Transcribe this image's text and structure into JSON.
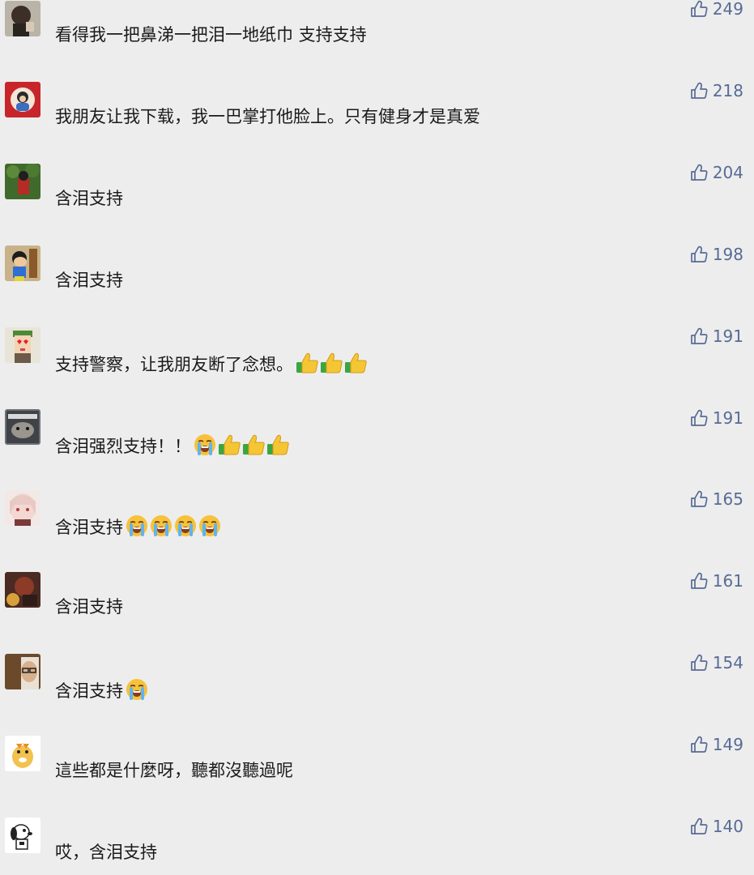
{
  "comments": [
    {
      "avatar": "avatar-dark-portrait",
      "text": "看得我一把鼻涕一把泪一地纸巾 支持支持",
      "emojis": [],
      "likes": "249"
    },
    {
      "avatar": "avatar-red-portrait",
      "text": "我朋友让我下载，我一巴掌打他脸上。只有健身才是真爱",
      "emojis": [],
      "likes": "218"
    },
    {
      "avatar": "avatar-green-outdoor",
      "text": "含泪支持",
      "emojis": [],
      "likes": "204"
    },
    {
      "avatar": "avatar-cartoon-boy",
      "text": "含泪支持",
      "emojis": [],
      "likes": "198"
    },
    {
      "avatar": "avatar-cartoon-heart-eyes",
      "text": "支持警察，让我朋友断了念想。",
      "emojis": [
        "thumbs-up-emoji",
        "thumbs-up-emoji",
        "thumbs-up-emoji"
      ],
      "likes": "191"
    },
    {
      "avatar": "avatar-cat",
      "text": "含泪强烈支持！！",
      "emojis": [
        "loudly-crying-emoji",
        "thumbs-up-emoji",
        "thumbs-up-emoji",
        "thumbs-up-emoji"
      ],
      "likes": "191"
    },
    {
      "avatar": "avatar-anime-girl",
      "text": "含泪支持",
      "emojis": [
        "loudly-crying-emoji",
        "loudly-crying-emoji",
        "loudly-crying-emoji",
        "loudly-crying-emoji"
      ],
      "likes": "165"
    },
    {
      "avatar": "avatar-dark-red",
      "text": "含泪支持",
      "emojis": [],
      "likes": "161"
    },
    {
      "avatar": "avatar-man-glasses",
      "text": "含泪支持",
      "emojis": [
        "loudly-crying-emoji"
      ],
      "likes": "154"
    },
    {
      "avatar": "avatar-yellow-dino",
      "text": "這些都是什麼呀，聽都沒聽過呢",
      "emojis": [],
      "likes": "149"
    },
    {
      "avatar": "avatar-snoopy",
      "text": "哎，含泪支持",
      "emojis": [],
      "likes": "140"
    }
  ],
  "colors": {
    "background": "#ededed",
    "like_count": "#576b95",
    "text": "#1a1a1a"
  }
}
